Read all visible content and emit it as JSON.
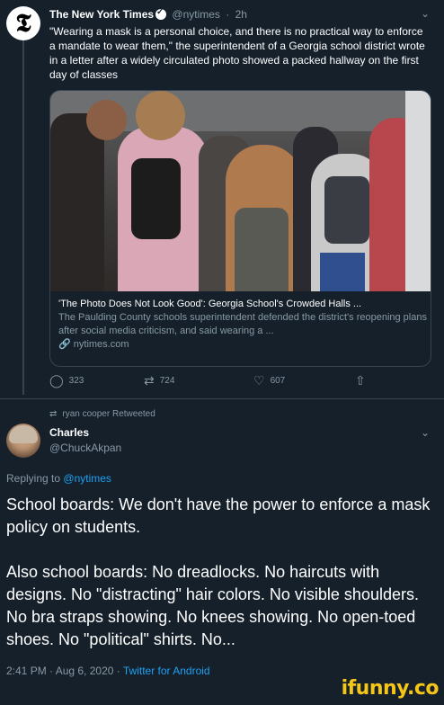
{
  "quoted_tweet": {
    "avatar_glyph": "𝕿",
    "author_name": "The New York Times",
    "author_handle": "@nytimes",
    "time_ago": "2h",
    "separator": "·",
    "text": "\"Wearing a mask is a personal choice, and there is no practical way to enforce a mandate to wear them,\" the superintendent of a Georgia school district wrote in a letter after a widely circulated photo showed a packed hallway on the first day of classes",
    "link_card": {
      "title": "'The Photo Does Not Look Good': Georgia School's Crowded Halls ...",
      "description": "The Paulding County schools superintendent defended the district's reopening plans after social media criticism, and said wearing a ...",
      "link_icon": "🔗",
      "domain": "nytimes.com"
    },
    "actions": {
      "reply_count": "323",
      "retweet_count": "724",
      "like_count": "607"
    }
  },
  "retweet_context": {
    "text": "ryan cooper Retweeted"
  },
  "main_tweet": {
    "author_name": "Charles",
    "author_handle": "@ChuckAkpan",
    "replying_prefix": "Replying to",
    "replying_handle": "@nytimes",
    "paragraph_1": "School boards: We don't have the power to enforce a mask policy on students.",
    "paragraph_2": "Also school boards: No dreadlocks. No haircuts with designs. No \"distracting\" hair colors. No visible shoulders. No bra straps showing. No knees showing. No open-toed shoes. No \"political\" shirts. No...",
    "timestamp": "2:41 PM · Aug 6, 2020 ·",
    "source": "Twitter for Android"
  },
  "watermark": "ifunny.co",
  "colors": {
    "background": "#15202b",
    "secondary_text": "#8899a6",
    "link": "#1da1f2",
    "border": "#38444d"
  },
  "icons": {
    "reply": "reply-icon",
    "retweet": "retweet-icon",
    "like": "heart-icon",
    "share": "share-icon",
    "more": "chevron-down-icon"
  }
}
